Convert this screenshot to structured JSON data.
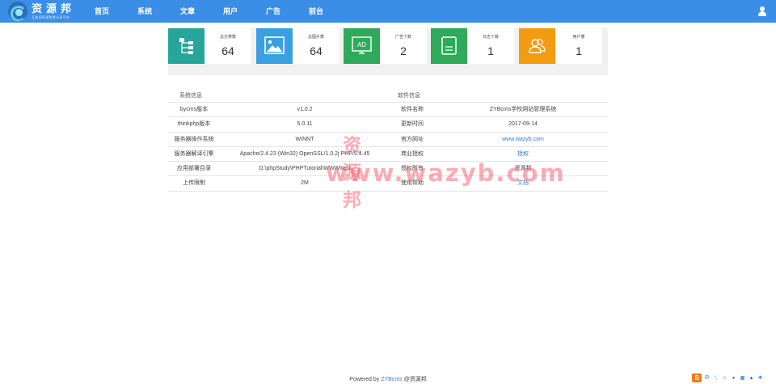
{
  "brand": {
    "title": "资源邦",
    "subtitle": "互联网资源免费分享平台"
  },
  "nav": [
    "首页",
    "系统",
    "文章",
    "用户",
    "广告",
    "前台"
  ],
  "stats": [
    {
      "label": "总分类数",
      "value": "64",
      "icon": "sitemap-icon",
      "color": "#26a69a"
    },
    {
      "label": "总图片数",
      "value": "64",
      "icon": "image-icon",
      "color": "#3aa0e0"
    },
    {
      "label": "广告个数",
      "value": "2",
      "icon": "ad-icon",
      "color": "#2eaa5a"
    },
    {
      "label": "日志个数",
      "value": "1",
      "icon": "log-icon",
      "color": "#2eaa5a"
    },
    {
      "label": "用户量",
      "value": "1",
      "icon": "users-icon",
      "color": "#f39c12"
    }
  ],
  "system_info": {
    "title": "系统信息",
    "rows": [
      {
        "key": "bycms版本",
        "value": "v1.0.2"
      },
      {
        "key": "thinkphp版本",
        "value": "5.0.11"
      },
      {
        "key": "服务器操作系统",
        "value": "WINNT"
      },
      {
        "key": "服务器解译引擎",
        "value": "Apache/2.4.23 (Win32) OpenSSL/1.0.2j PHP/5.4.45"
      },
      {
        "key": "应用部署目录",
        "value": "D:\\phpStudy\\PHPTutorial\\WWW\\test"
      },
      {
        "key": "上传限制",
        "value": "2M"
      }
    ]
  },
  "software_info": {
    "title": "软件信息",
    "rows": [
      {
        "key": "软件名称",
        "value": "ZYBcms学校网站管理系统"
      },
      {
        "key": "更新时间",
        "value": "2017-09-14"
      },
      {
        "key": "官方网址",
        "value": "www.wazyb.com"
      },
      {
        "key": "商业授权",
        "value": "授权"
      },
      {
        "key": "授权所有",
        "value": "资源邦"
      },
      {
        "key": "使用帮助",
        "value": "文档"
      }
    ]
  },
  "watermark": {
    "line1": "资源邦",
    "line2": "www.wazyb.com"
  },
  "footer": {
    "prefix": "Powered by",
    "brand": "ZYBcms",
    "suffix": "@资源邦"
  },
  "tray": {
    "ime_label": "S",
    "lang": "中"
  }
}
